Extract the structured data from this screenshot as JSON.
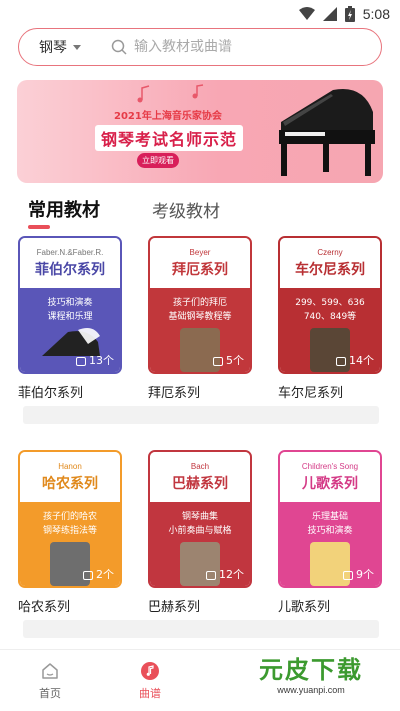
{
  "status": {
    "time": "5:08"
  },
  "search": {
    "category": "钢琴",
    "placeholder": "输入教材或曲谱"
  },
  "banner": {
    "year_text": "2021年上海音乐家协会",
    "title": "钢琴考试名师示范",
    "tag": "立即观看"
  },
  "tabs": [
    {
      "label": "常用教材",
      "active": true
    },
    {
      "label": "考级教材",
      "active": false
    }
  ],
  "rows": [
    [
      {
        "en": "Faber.N.&Faber.R.",
        "cn": "菲伯尔系列",
        "desc": [
          "技巧和演奏",
          "课程和乐理"
        ],
        "count": "13个",
        "title": "菲伯尔系列",
        "color": "#5a56b8",
        "top": "#ffffff"
      },
      {
        "en": "Beyer",
        "cn": "拜厄系列",
        "desc": [
          "孩子们的拜厄",
          "基础钢琴教程等"
        ],
        "count": "5个",
        "title": "拜厄系列",
        "color": "#c1373b",
        "top": "#ffffff"
      },
      {
        "en": "Czerny",
        "cn": "车尔尼系列",
        "desc": [
          "299、599、636",
          "740、849等"
        ],
        "count": "14个",
        "title": "车尔尼系列",
        "color": "#b82f33",
        "top": "#ffffff"
      }
    ],
    [
      {
        "en": "Hanon",
        "cn": "哈农系列",
        "desc": [
          "孩子们的哈农",
          "钢琴练指法等"
        ],
        "count": "2个",
        "title": "哈农系列",
        "color": "#f39b2a",
        "top": "#ffffff"
      },
      {
        "en": "Bach",
        "cn": "巴赫系列",
        "desc": [
          "钢琴曲集",
          "小前奏曲与赋格"
        ],
        "count": "12个",
        "title": "巴赫系列",
        "color": "#c1363f",
        "top": "#ffffff"
      },
      {
        "en": "Children's Song",
        "cn": "儿歌系列",
        "desc": [
          "乐理基础",
          "技巧和演奏"
        ],
        "count": "9个",
        "title": "儿歌系列",
        "color": "#e04692",
        "top": "#ffffff"
      }
    ]
  ],
  "nav": [
    {
      "label": "首页",
      "active": false
    },
    {
      "label": "曲谱",
      "active": true
    }
  ],
  "watermark": {
    "main": "元皮下载",
    "sub": "www.yuanpi.com"
  }
}
